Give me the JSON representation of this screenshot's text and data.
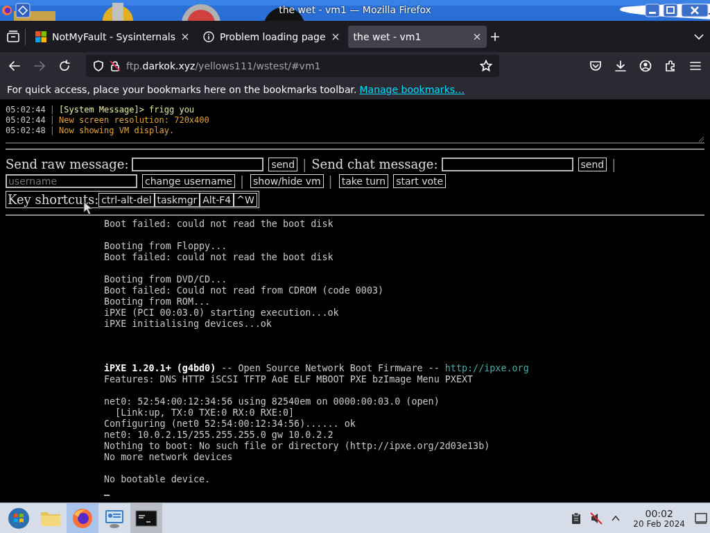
{
  "window": {
    "title": "the wet - vm1 — Mozilla Firefox"
  },
  "tabs": [
    {
      "label": "NotMyFault - Sysinternals",
      "kind": "windows",
      "selected": false
    },
    {
      "label": "Problem loading page",
      "kind": "info",
      "selected": false
    },
    {
      "label": "the wet - vm1",
      "kind": "plain",
      "selected": true
    }
  ],
  "navigation": {
    "back_disabled": false,
    "forward_disabled": true
  },
  "address": {
    "subdomain": "ftp.",
    "domain": "darkok.xyz",
    "path": "/yellows111/wstest/#vm1"
  },
  "bookmarks_bar": {
    "message": "For quick access, place your bookmarks here on the bookmarks toolbar.",
    "link": "Manage bookmarks…"
  },
  "chat_log": [
    {
      "time": "05:02:44",
      "separator": "|",
      "message": "[System Message]> frigg you",
      "color": "#e8e89c"
    },
    {
      "time": "05:02:44",
      "separator": "|",
      "message": "New screen resolution: 720x400",
      "color": "#e0a33c"
    },
    {
      "time": "05:02:48",
      "separator": "|",
      "message": "Now showing VM display.",
      "color": "#e0a33c"
    }
  ],
  "control_rows": [
    [
      {
        "kind": "label",
        "text": "Send raw message:"
      },
      {
        "kind": "input"
      },
      {
        "kind": "button",
        "text": "send"
      },
      {
        "kind": "separator",
        "text": "|"
      },
      {
        "kind": "label",
        "text": "Send chat message:"
      },
      {
        "kind": "input"
      },
      {
        "kind": "button",
        "text": "send"
      },
      {
        "kind": "separator",
        "text": "|"
      }
    ],
    [
      {
        "kind": "input",
        "placeholder": "username"
      },
      {
        "kind": "button",
        "text": "change username"
      },
      {
        "kind": "separator",
        "text": "|"
      },
      {
        "kind": "button",
        "text": "show/hide vm"
      },
      {
        "kind": "separator",
        "text": "|"
      },
      {
        "kind": "button",
        "text": "take turn"
      },
      {
        "kind": "button",
        "text": "start vote"
      }
    ]
  ],
  "key_shortcuts": {
    "label": "Key shortcuts:",
    "buttons": [
      "ctrl-alt-del",
      "taskmgr",
      "Alt-F4",
      "^W"
    ]
  },
  "vm_screen": {
    "lines": [
      {
        "kind": "text",
        "text": "Boot failed: could not read the boot disk"
      },
      {
        "kind": "blank"
      },
      {
        "kind": "text",
        "text": "Booting from Floppy..."
      },
      {
        "kind": "text",
        "text": "Boot failed: could not read the boot disk"
      },
      {
        "kind": "blank"
      },
      {
        "kind": "text",
        "text": "Booting from DVD/CD..."
      },
      {
        "kind": "text",
        "text": "Boot failed: Could not read from CDROM (code 0003)"
      },
      {
        "kind": "text",
        "text": "Booting from ROM..."
      },
      {
        "kind": "text",
        "text": "iPXE (PCI 00:03.0) starting execution...ok"
      },
      {
        "kind": "text",
        "text": "iPXE initialising devices...ok"
      },
      {
        "kind": "blank"
      },
      {
        "kind": "blank"
      },
      {
        "kind": "blank"
      },
      {
        "kind": "banner",
        "text": "iPXE 1.20.1+ (g4bd0)",
        "rest": " -- Open Source Network Boot Firmware -- ",
        "link": "http://ipxe.org"
      },
      {
        "kind": "text",
        "text": "Features: DNS HTTP iSCSI TFTP AoE ELF MBOOT PXE bzImage Menu PXEXT"
      },
      {
        "kind": "blank"
      },
      {
        "kind": "text",
        "text": "net0: 52:54:00:12:34:56 using 82540em on 0000:00:03.0 (open)"
      },
      {
        "kind": "text",
        "text": "  [Link:up, TX:0 TXE:0 RX:0 RXE:0]"
      },
      {
        "kind": "text",
        "text": "Configuring (net0 52:54:00:12:34:56)...... ok"
      },
      {
        "kind": "text",
        "text": "net0: 10.0.2.15/255.255.255.0 gw 10.0.2.2"
      },
      {
        "kind": "text",
        "text": "Nothing to boot: No such file or directory (http://ipxe.org/2d03e13b)"
      },
      {
        "kind": "text",
        "text": "No more network devices"
      },
      {
        "kind": "blank"
      },
      {
        "kind": "text",
        "text": "No bootable device."
      },
      {
        "kind": "cursor",
        "text": "_"
      }
    ]
  },
  "taskbar": {
    "apps": [
      {
        "kind": "start",
        "active": false,
        "running": false
      },
      {
        "kind": "folder",
        "active": false,
        "running": false
      },
      {
        "kind": "firefox",
        "active": true,
        "running": true
      },
      {
        "kind": "remote",
        "active": false,
        "running": false
      },
      {
        "kind": "terminal",
        "active": false,
        "running": true
      }
    ],
    "clock": {
      "time": "00:02",
      "date": "20 Feb 2024"
    }
  }
}
